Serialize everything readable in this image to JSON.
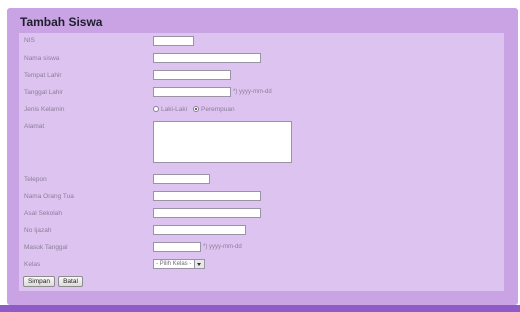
{
  "form": {
    "title": "Tambah Siswa",
    "fields": {
      "nis": {
        "label": "NIS"
      },
      "nama_siswa": {
        "label": "Nama siswa"
      },
      "tempat_lahir": {
        "label": "Tempat Lahir"
      },
      "tanggal_lahir": {
        "label": "Tanggal Lahir",
        "hint": "*) yyyy-mm-dd"
      },
      "jenis_kelamin": {
        "label": "Jenis Kelamin",
        "options": [
          "Laki-Laki",
          "Perempuan"
        ],
        "selected": "Perempuan"
      },
      "alamat": {
        "label": "Alamat"
      },
      "telepon": {
        "label": "Telepon"
      },
      "nama_orang_tua": {
        "label": "Nama Orang Tua"
      },
      "asal_sekolah": {
        "label": "Asal Sekolah"
      },
      "no_ijazah": {
        "label": "No Ijazah"
      },
      "masuk_tanggal": {
        "label": "Masuk Tanggal",
        "hint": "*) yyyy-mm-dd"
      },
      "kelas": {
        "label": "Kelas",
        "selected_text": "- Pilih Kelas -"
      }
    },
    "buttons": {
      "save": "Simpan",
      "cancel": "Batal"
    }
  },
  "colors": {
    "panel": "#c9a3e4",
    "form_area": "#ddc3ef",
    "footer": "#8e5bc7"
  }
}
